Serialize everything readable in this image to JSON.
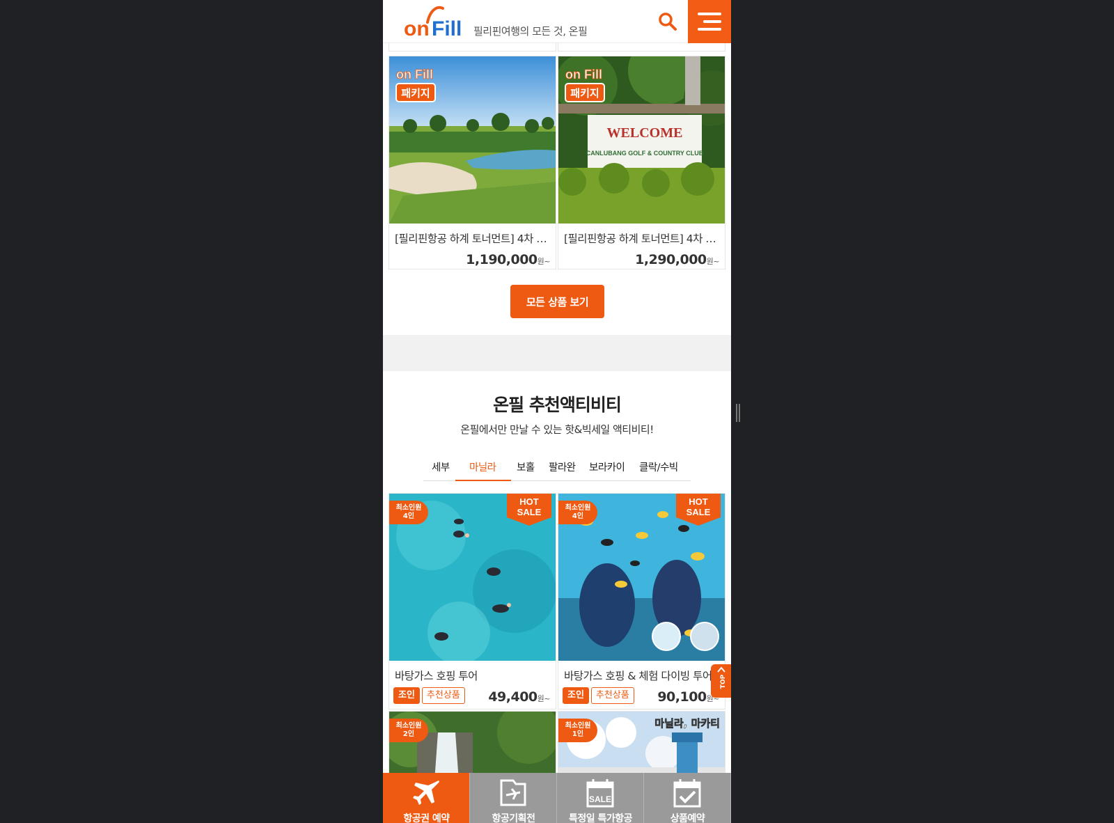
{
  "header": {
    "tagline": "필리핀여행의 모든 것, 온필",
    "logo_text_on": "on",
    "logo_text_fill": "Fill"
  },
  "package_cards": [
    {
      "title": "[필리핀항공 하계 토너먼트] 4차 …",
      "price": "1,190,000",
      "price_unit": "원~",
      "badge_line1": "on Fill",
      "badge_line2": "패키지"
    },
    {
      "title": "[필리핀항공 하계 토너먼트] 4차 …",
      "price": "1,290,000",
      "price_unit": "원~",
      "badge_line1": "on Fill",
      "badge_line2": "패키지",
      "sign_line1": "WELCOME",
      "sign_line2": "CANLUBANG GOLF & COUNTRY CLUB"
    }
  ],
  "all_products_button": "모든 상품 보기",
  "activity_section": {
    "title": "온필 추천액티비티",
    "subtitle": "온필에서만 만날 수 있는 핫&빅세일 액티비티!",
    "tabs": [
      "세부",
      "마닐라",
      "보홀",
      "팔라완",
      "보라카이",
      "클락/수빅"
    ],
    "active_tab": "마닐라"
  },
  "activity_cards": [
    {
      "title": "바탕가스 호핑 투어",
      "price": "49,400",
      "price_unit": "원~",
      "min_label": "최소인원",
      "min_count": "4인",
      "hot_line1": "HOT",
      "hot_line2": "SALE",
      "tag1": "조인",
      "tag2": "추천상품"
    },
    {
      "title": "바탕가스 호핑 & 체험 다이빙 투어",
      "price": "90,100",
      "price_unit": "원~",
      "min_label": "최소인원",
      "min_count": "4인",
      "hot_line1": "HOT",
      "hot_line2": "SALE",
      "tag1": "조인",
      "tag2": "추천상품"
    },
    {
      "min_label": "최소인원",
      "min_count": "2인"
    },
    {
      "min_label": "최소인원",
      "min_count": "1인",
      "overlay_text": "마닐라, 마카티"
    }
  ],
  "top_button": "TOP",
  "bottom_nav": [
    {
      "label": "항공권 예약",
      "icon": "airplane-icon"
    },
    {
      "label": "항공기획전",
      "icon": "flight-folder-icon"
    },
    {
      "label": "특정일 특가항공",
      "icon": "sale-calendar-icon"
    },
    {
      "label": "상품예약",
      "icon": "check-calendar-icon"
    }
  ],
  "colors": {
    "accent": "#ee5a12",
    "logo_blue": "#1f6fd1",
    "nav_inactive": "#9a9a9a",
    "backdrop": "#202124"
  }
}
